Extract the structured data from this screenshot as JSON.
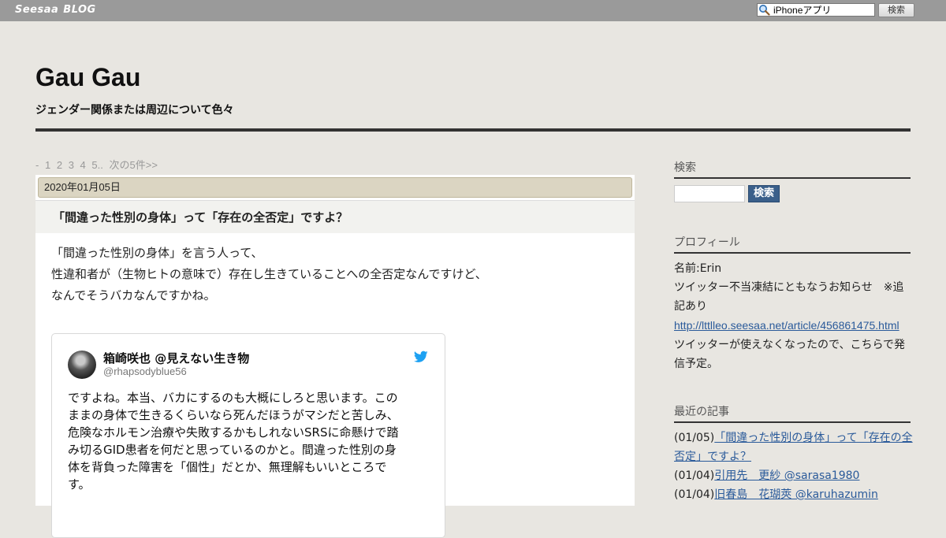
{
  "topbar": {
    "logo_main": "Seesaa",
    "logo_sub": "BLOG",
    "search_value": "iPhoneアプリ",
    "search_button": "検索"
  },
  "header": {
    "title": "Gau Gau",
    "description": "ジェンダー関係または周辺について色々"
  },
  "pager": {
    "items": [
      "-",
      "1",
      "2",
      "3",
      "4",
      "5..",
      "次の5件>>"
    ]
  },
  "article": {
    "date": "2020年01月05日",
    "title": "「間違った性別の身体」って「存在の全否定」ですよ？",
    "body_lines": [
      "「間違った性別の身体」を言う人って、",
      "性違和者が（生物ヒトの意味で）存在し生きていることへの全否定なんですけど、",
      "なんでそうバカなんですかね。"
    ],
    "tweet": {
      "name": "箱崎咲也 @見えない生き物",
      "handle": "@rhapsodyblue56",
      "text_lines": [
        "ですよね。本当、バカにするのも大概にしろと思います。この",
        "ままの身体で生きるくらいなら死んだほうがマシだと苦しみ、",
        "危険なホルモン治療や失敗するかもしれないSRSに命懸けで踏",
        "み切るGID患者を何だと思っているのかと。間違った性別の身",
        "体を背負った障害を「個性」だとか、無理解もいいところで",
        "す。"
      ]
    }
  },
  "sidebar": {
    "search_heading": "検索",
    "search_button": "検索",
    "profile_heading": "プロフィール",
    "profile_lines": [
      "名前:Erin",
      "ツイッター不当凍結にともなうお知らせ　※追",
      "記あり"
    ],
    "profile_link": "http://lttlleo.seesaa.net/article/456861475.html",
    "profile_after": [
      "ツイッターが使えなくなったので、こちらで発",
      "信予定。"
    ],
    "recent_heading": "最近の記事",
    "recent": [
      {
        "date": "(01/05)",
        "title_line1": "「間違った性別の身体」って「存在の全",
        "title_line2": "否定」ですよ？"
      },
      {
        "date": "(01/04)",
        "title_line1": "引用先　更紗 @sarasa1980"
      },
      {
        "date": "(01/04)",
        "title_line1": "旧春島　花瑚莢 @karuhazumin"
      }
    ]
  }
}
